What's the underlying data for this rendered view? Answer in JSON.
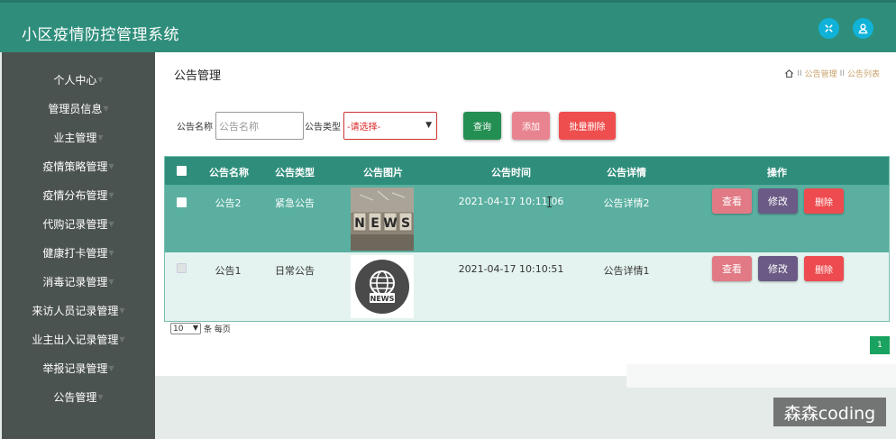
{
  "app": {
    "title": "小区疫情防控管理系统"
  },
  "header_icons": [
    "shrink-icon",
    "user-icon"
  ],
  "sidebar": {
    "items": [
      {
        "label": "个人中心"
      },
      {
        "label": "管理员信息"
      },
      {
        "label": "业主管理"
      },
      {
        "label": "疫情策略管理"
      },
      {
        "label": "疫情分布管理"
      },
      {
        "label": "代购记录管理"
      },
      {
        "label": "健康打卡管理"
      },
      {
        "label": "消毒记录管理"
      },
      {
        "label": "来访人员记录管理"
      },
      {
        "label": "业主出入记录管理"
      },
      {
        "label": "举报记录管理"
      },
      {
        "label": "公告管理"
      }
    ]
  },
  "page": {
    "title": "公告管理",
    "breadcrumb": [
      "公告管理",
      "公告列表"
    ],
    "breadcrumb_sep": "II"
  },
  "filters": {
    "name_label": "公告名称",
    "name_placeholder": "公告名称",
    "type_label": "公告类型",
    "type_selected": "-请选择-"
  },
  "toolbar": {
    "query_label": "查询",
    "add_label": "添加",
    "batch_delete_label": "批量删除"
  },
  "table": {
    "columns": [
      "公告名称",
      "公告类型",
      "公告图片",
      "公告时间",
      "公告详情",
      "操作"
    ],
    "rows": [
      {
        "name": "公告2",
        "type": "紧急公告",
        "image": "news-photo",
        "time": "2021-04-17 10:11:06",
        "detail": "公告详情2",
        "actions": [
          "查看",
          "修改",
          "删除"
        ]
      },
      {
        "name": "公告1",
        "type": "日常公告",
        "image": "news-globe-icon",
        "time": "2021-04-17 10:10:51",
        "detail": "公告详情1",
        "actions": [
          "查看",
          "修改",
          "删除"
        ]
      }
    ]
  },
  "pagination": {
    "page_size": "10",
    "page_size_suffix": "条 每页",
    "current_page": "1"
  },
  "watermark": "森森coding",
  "colors": {
    "header": "#2f8e7b",
    "sidebar": "#4b5351",
    "query_button": "#248f52",
    "add_button": "#e8848f",
    "delete_button": "#ef4e4e",
    "edit_button": "#6a5a85",
    "pager": "#1aa260"
  }
}
